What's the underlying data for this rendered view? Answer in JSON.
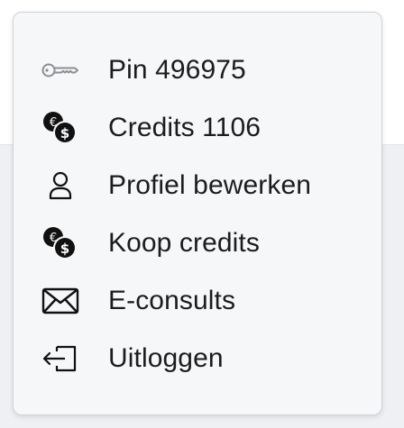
{
  "menu": {
    "items": [
      {
        "icon": "key-icon",
        "label": "Pin 496975"
      },
      {
        "icon": "euro-dollar-coins-icon",
        "label": "Credits 1106"
      },
      {
        "icon": "user-icon",
        "label": "Profiel bewerken"
      },
      {
        "icon": "euro-dollar-coins-icon",
        "label": "Koop credits"
      },
      {
        "icon": "envelope-icon",
        "label": "E-consults"
      },
      {
        "icon": "logout-icon",
        "label": "Uitloggen"
      }
    ]
  },
  "colors": {
    "menu_background": "#f6f7f9",
    "menu_border": "#cfd2d7",
    "text": "#1b1c1e",
    "key_icon": "#8e8f93",
    "icon_dark": "#111111"
  }
}
